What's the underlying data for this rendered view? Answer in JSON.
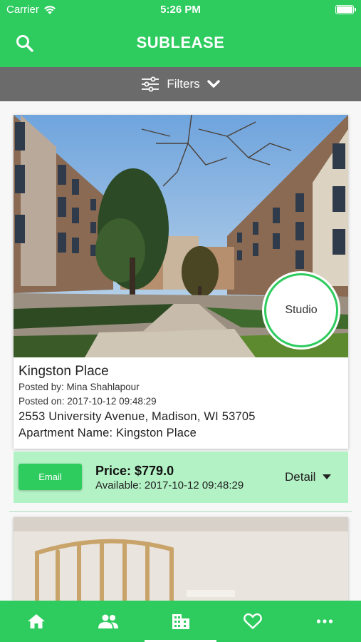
{
  "status_bar": {
    "carrier": "Carrier",
    "time": "5:26 PM"
  },
  "header": {
    "title": "SUBLEASE",
    "search_icon": "search-icon"
  },
  "filters": {
    "label": "Filters",
    "icon": "sliders-icon",
    "chevron": "chevron-down-icon"
  },
  "listing": {
    "badge": "Studio",
    "name": "Kingston Place",
    "posted_by": "Posted by: Mina Shahlapour",
    "posted_on": "Posted on: 2017-10-12 09:48:29",
    "address": "2553 University Avenue, Madison, WI 53705",
    "apartment_name": "Apartment Name: Kingston Place",
    "email_label": "Email",
    "price": "Price: $779.0",
    "available": "Available: 2017-10-12 09:48:29",
    "detail_label": "Detail"
  },
  "tabbar": {
    "items": [
      {
        "icon": "home-icon",
        "active": false
      },
      {
        "icon": "people-icon",
        "active": false
      },
      {
        "icon": "building-icon",
        "active": true
      },
      {
        "icon": "heart-icon",
        "active": false
      },
      {
        "icon": "more-icon",
        "active": false
      }
    ]
  },
  "colors": {
    "brand": "#2ecc5f",
    "filters_bar": "#6b6b6b",
    "action_bar": "#b3f2c5"
  }
}
